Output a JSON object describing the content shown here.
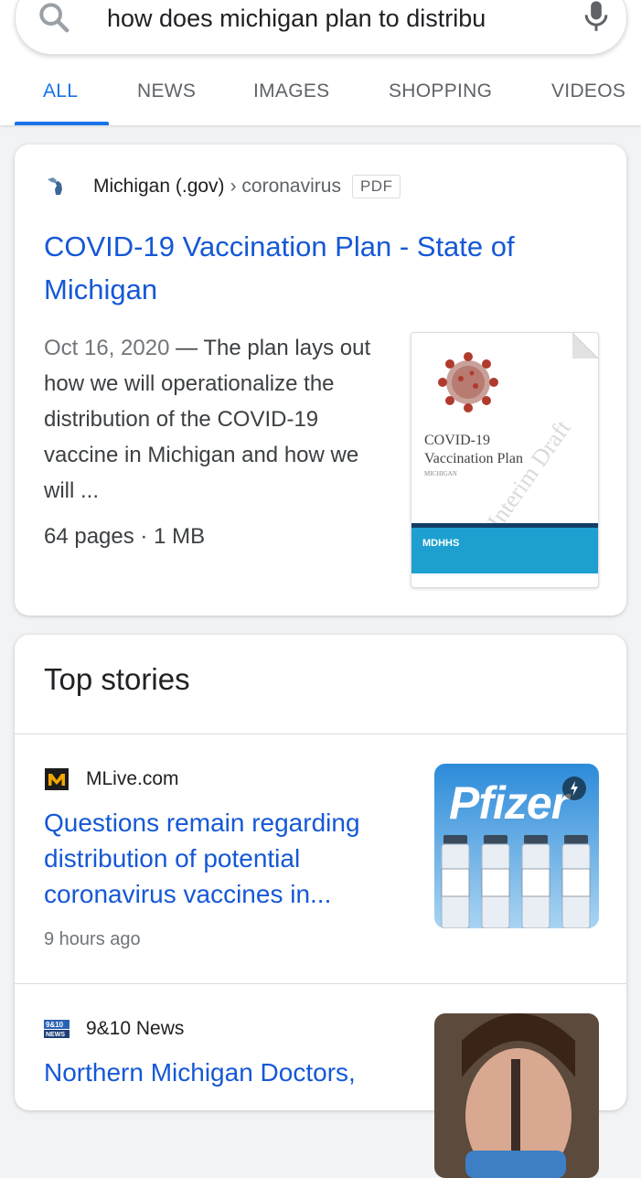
{
  "search": {
    "query": "how does michigan plan to distribu"
  },
  "tabs": [
    {
      "label": "ALL",
      "active": true
    },
    {
      "label": "NEWS",
      "active": false
    },
    {
      "label": "IMAGES",
      "active": false
    },
    {
      "label": "SHOPPING",
      "active": false
    },
    {
      "label": "VIDEOS",
      "active": false
    }
  ],
  "result": {
    "source_name": "Michigan (.gov)",
    "breadcrumb": "› coronavirus",
    "file_type": "PDF",
    "title": "COVID-19 Vaccination Plan - State of Michigan",
    "date": "Oct 16, 2020",
    "snippet": " — The plan lays out how we will operationalize the distribution of the COVID-19 vaccine in Michigan and how we will ...",
    "meta": "64 pages · 1 MB",
    "thumbnail": {
      "title_line1": "COVID-19",
      "title_line2": "Vaccination Plan",
      "subtitle": "MICHIGAN",
      "watermark": "Interim Draft",
      "brand": "MDHHS"
    }
  },
  "top_stories": {
    "heading": "Top stories",
    "items": [
      {
        "source": "MLive.com",
        "title": "Questions remain regarding distribution of potential coronavirus vaccines in...",
        "time": "9 hours ago",
        "image_text": "Pfizer"
      },
      {
        "source": "9&10 News",
        "title": "Northern Michigan Doctors,",
        "time": ""
      }
    ]
  },
  "colors": {
    "link": "#1558d6",
    "accent": "#1a73e8",
    "secondary_text": "#70757a"
  }
}
